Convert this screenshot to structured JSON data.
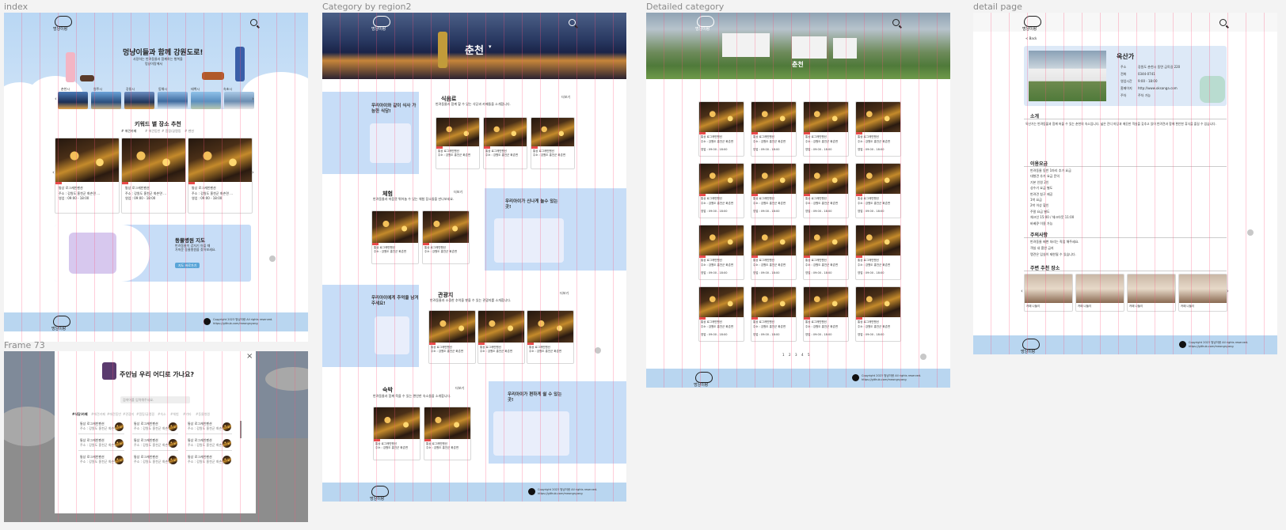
{
  "frames": {
    "index": "index",
    "region": "Category by region2",
    "detailed": "Detailed category",
    "detail": "detail page",
    "frame73": "Frame 73"
  },
  "logo_text": "멍냥이랑",
  "index_page": {
    "hero_title": "멍냥이들과 함께 강원도로!",
    "hero_sub1": "사랑하는 반려동물과 함께하는 행복을",
    "hero_sub2": "멍냥이랑에서",
    "region_tabs": [
      "춘천시",
      "원주시",
      "강릉시",
      "동해시",
      "태백시",
      "속초시"
    ],
    "keyword_title": "키워드 별 장소 추천",
    "keywords": [
      "# 애견카페",
      "# 애견동반",
      "# 캠핑/글램핑",
      "# 펜션"
    ],
    "place_cards": [
      {
        "name": "통상 로그캐빈펜션",
        "addr": "주소 : 강원도 홍천군 화촌면 ...",
        "info": "영업 : 09:00 - 18:00"
      },
      {
        "name": "통상 로그캐빈펜션",
        "addr": "주소 : 강원도 홍천군 화촌면 ...",
        "info": "영업 : 09:00 - 18:00"
      },
      {
        "name": "통상 로그캐빈펜션",
        "addr": "주소 : 강원도 홍천군 화촌면 ...",
        "info": "영업 : 09:00 - 18:00"
      }
    ],
    "map_title": "동물병원 지도",
    "map_desc1": "반려동물이 갑자기 아플 때",
    "map_desc2": "가까운 동물병원을 찾아보세요.",
    "map_button": "지도 바로가기"
  },
  "modal": {
    "title": "주인님 우리 어디로 가나요?",
    "search_placeholder": "검색어를 입력해주세요.",
    "tabs": [
      "#식당/카페",
      "#애견카페",
      "#애견동반",
      "#관광지",
      "#캠핑/글램핑",
      "#숙소",
      "#체험",
      "#기타",
      "#동물병원"
    ],
    "item_title": "통상 로그캐빈펜션",
    "item_desc": "주소 : 강원도 홍천군 화촌면 ...",
    "close": "×"
  },
  "region_page": {
    "city": "춘천",
    "sections": [
      {
        "title": "식음료",
        "desc": "반려동물과 함께 할 수 있는 식당과 카페들을 소개합니다.",
        "more": "더보기"
      },
      {
        "title": "체험",
        "desc": "반려동물과 마음껏 뛰어놀 수 있는 체험 장소들을 만나보세요.",
        "more": "더보기"
      },
      {
        "title": "관광지",
        "desc": "반려동물과 소중한 추억을 쌓을 수 있는 관광지를 소개합니다.",
        "more": "더보기"
      },
      {
        "title": "숙박",
        "desc": "반려동물과 함께 묵을 수 있는 편안한 숙소들을 소개합니다.",
        "more": "더보기"
      }
    ],
    "promos": [
      "우리아이와 같이 식사 가능한 식당!",
      "우리아이가 신나게 놀수 있는 곳!",
      "우리아이에게 추억을 남겨주세요!",
      "우리아이가 편하게 쉴 수 있는 곳!"
    ],
    "card_title": "통상 로그캐빈펜션",
    "card_desc": "주소 : 강원도 홍천군 화촌면"
  },
  "detailed_page": {
    "city": "춘천",
    "card_title": "통상 로그캐빈펜션",
    "card_line1": "주소 : 강원도 홍천군 화촌면",
    "card_line2": "영업 : 09:00 - 18:00",
    "pagination": [
      "1",
      "2",
      "3",
      "4",
      "5"
    ]
  },
  "detail_page": {
    "back": "< Back",
    "place_name": "옥산가",
    "info": [
      {
        "label": "주소",
        "value": "강원도 춘천시 동면 금옥길 220"
      },
      {
        "label": "전화",
        "value": "0344-0741"
      },
      {
        "label": "영업시간",
        "value": "9:00 - 18:00"
      },
      {
        "label": "홈페이지",
        "value": "http://www.oksanga.com"
      },
      {
        "label": "주차",
        "value": "주차 가능"
      }
    ],
    "intro_title": "소개",
    "intro_text": "옥산가는 반려동물과 함께 머물 수 있는 춘천의 숙소입니다. 넓은 잔디 마당과 깨끗한 객실을 갖추고 있어 반려견과 함께 편안한 휴식을 즐길 수 있습니다.",
    "usage_title": "이용요금",
    "usage_items": [
      "반려동물 동반 1마리 추가 요금",
      "대형견 추가 요금 문의",
      "기본 인원 2인",
      "성수기 요금 별도",
      "반려견 침구 제공",
      "1박 요금",
      "2박 이상 할인",
      "주말 요금 별도",
      "체크인 15:00 / 체크아웃 11:00",
      "바베큐 이용 가능"
    ],
    "notice_title": "주의사항",
    "notice_items": [
      "반려동물 배변 처리는 직접 해주세요.",
      "객실 내 흡연 금지",
      "맹견은 입실이 제한될 수 있습니다."
    ],
    "nearby_title": "주변 추천 장소",
    "nearby": [
      "카페 나들이",
      "카페 나들이",
      "카페 나들이",
      "카페 나들이"
    ]
  },
  "footer": {
    "line1": "Copyright 2023 멍냥이랑 All rights reserved.",
    "line2": "https://github.com/meongnyang"
  }
}
